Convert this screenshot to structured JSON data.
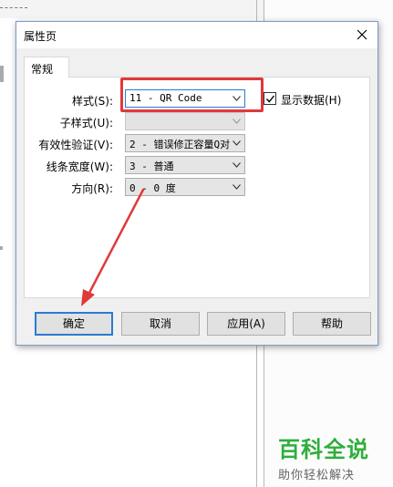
{
  "dialog": {
    "title": "属性页",
    "tab_label": "常规"
  },
  "fields": [
    {
      "label": "样式(S):",
      "value": "11 - QR Code"
    },
    {
      "label": "子样式(U):",
      "value": ""
    },
    {
      "label": "有效性验证(V):",
      "value": "2 - 错误修正容量Q对"
    },
    {
      "label": "线条宽度(W):",
      "value": "3 - 普通"
    },
    {
      "label": "方向(R):",
      "value": "0 - 0 度"
    }
  ],
  "show_data": {
    "label": "显示数据(H)",
    "checked": true
  },
  "buttons": {
    "ok": "确定",
    "cancel": "取消",
    "apply": "应用(A)",
    "help": "帮助"
  },
  "colors": {
    "highlight": "#e0393b",
    "watermark": "#2fae3b",
    "accent": "#2a7ad5"
  },
  "watermark": {
    "brand": "百科全说",
    "slogan": "助你轻松解决"
  }
}
